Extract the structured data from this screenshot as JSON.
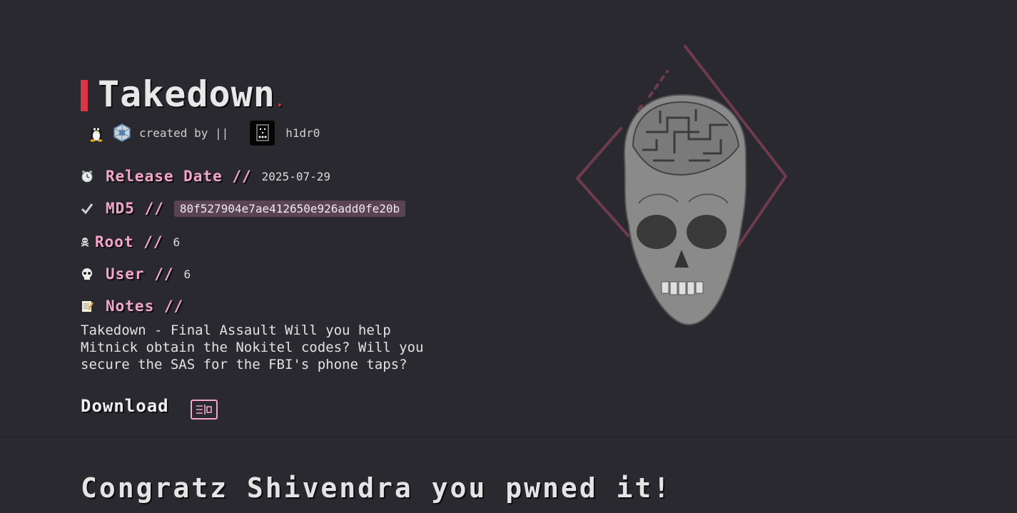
{
  "machine": {
    "title": "Takedown",
    "title_dot": ".",
    "created_by_label": "created by ||",
    "author": "h1dr0"
  },
  "icons": {
    "os": "linux-penguin-icon",
    "platform": "virtualbox-icon",
    "avatar": "author-avatar",
    "release": "alarm-clock-icon",
    "md5": "check-mark-icon",
    "root": "skull-crossbones-icon",
    "user": "skull-icon",
    "notes": "memo-icon",
    "download": "download-icon"
  },
  "fields": {
    "release": {
      "label": "Release Date //",
      "value": "2025-07-29"
    },
    "md5": {
      "label": "MD5 //",
      "value": "80f527904e7ae412650e926add0fe20b"
    },
    "root": {
      "label": "Root //",
      "value": "6"
    },
    "user": {
      "label": "User //",
      "value": "6"
    },
    "notes": {
      "label": "Notes //",
      "text": "Takedown - Final Assault Will you help Mitnick obtain the Nokitel codes? Will you secure the SAS for the FBI's phone taps?"
    }
  },
  "download": {
    "label": "Download"
  },
  "congrats": {
    "text": "Congratz Shivendra you pwned it!"
  },
  "colors": {
    "background": "#2a292f",
    "accent_red": "#dc3545",
    "label_pink": "#f4a6c8",
    "md5_bg": "#5a4353",
    "diamond": "#6e3a4c"
  }
}
